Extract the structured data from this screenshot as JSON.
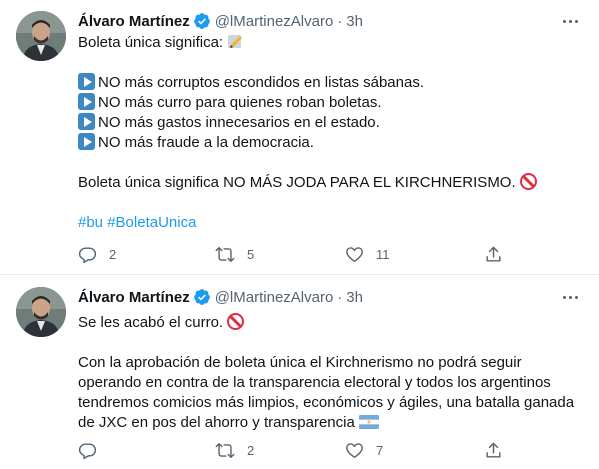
{
  "tweets": [
    {
      "author": {
        "name": "Álvaro Martínez",
        "handle": "@lMartinezAlvaro",
        "dot": "·",
        "time": "3h"
      },
      "lines": {
        "l1": "Boleta única significa:",
        "l2": "NO más corruptos escondidos en listas sábanas.",
        "l3": "NO más curro para quienes roban boletas.",
        "l4": "NO más gastos innecesarios en el estado.",
        "l5": "NO más fraude a la democracia.",
        "l6": "Boleta única significa NO MÁS JODA PARA EL KIRCHNERISMO."
      },
      "hashtags": [
        "#bu",
        "#BoletaUnica"
      ],
      "stats": {
        "replies": "2",
        "retweets": "5",
        "likes": "11"
      },
      "emojis": [
        "pencil-emoji",
        "play-button-emoji",
        "no-entry-emoji"
      ]
    },
    {
      "author": {
        "name": "Álvaro Martínez",
        "handle": "@lMartinezAlvaro",
        "dot": "·",
        "time": "3h"
      },
      "lines": {
        "l1": "Se les acabó el curro.",
        "l2": "Con la aprobación de boleta única el Kirchnerismo no podrá seguir",
        "l3": "operando en contra de la transparencia electoral y todos los argentinos",
        "l4": "tendremos comicios más limpios, económicos y ágiles, una batalla ganada",
        "l5": "de JXC en pos del ahorro y transparencia"
      },
      "stats": {
        "replies": "",
        "retweets": "2",
        "likes": "7"
      },
      "emojis": [
        "no-entry-emoji",
        "argentina-flag-emoji"
      ]
    }
  ],
  "colors": {
    "text": "#0f1419",
    "secondary": "#536471",
    "link": "#1d9bf0",
    "verified": "#1d9bf0",
    "divider": "#e6ecf0"
  }
}
